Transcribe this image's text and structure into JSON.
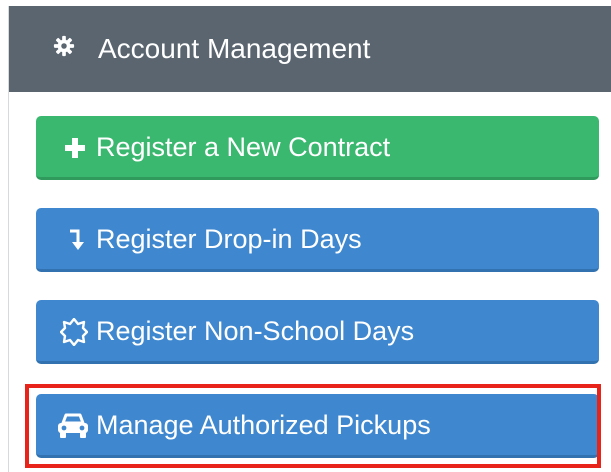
{
  "panel": {
    "header": {
      "title": "Account Management",
      "icon": "gear-icon"
    },
    "buttons": [
      {
        "label": "Register a New Contract",
        "icon": "plus-icon",
        "color": "#3bb870"
      },
      {
        "label": "Register Drop-in Days",
        "icon": "arrow-down-turn-icon",
        "color": "#3f88cf"
      },
      {
        "label": "Register Non-School Days",
        "icon": "sun-outline-icon",
        "color": "#3f88cf"
      },
      {
        "label": "Manage Authorized Pickups",
        "icon": "car-icon",
        "color": "#3f88cf"
      }
    ]
  },
  "highlight": {
    "color": "#e8231a"
  }
}
